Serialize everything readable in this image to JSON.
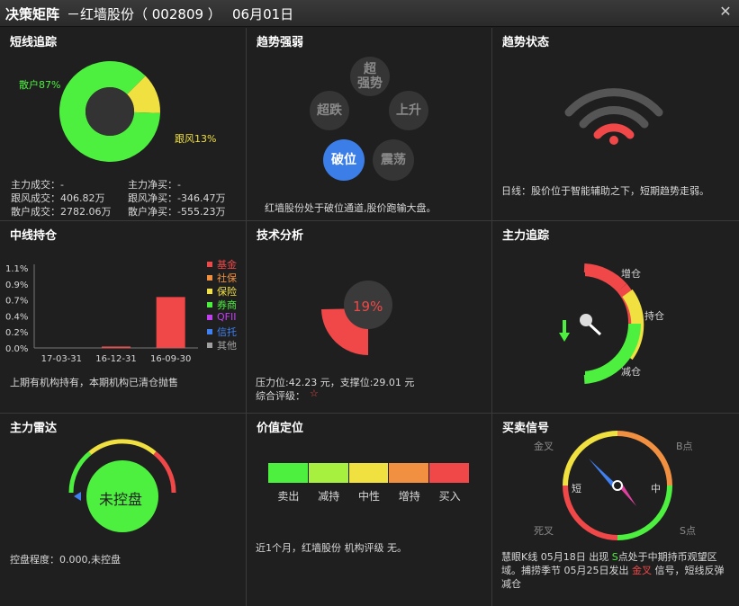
{
  "title_bar": {
    "title": "决策矩阵",
    "stock": "－红墙股份（ 002809 ）",
    "date": "06月01日",
    "close_icon": "close-icon"
  },
  "short_track": {
    "title": "短线追踪",
    "retail_pct_label": "散户87%",
    "follow_pct_label": "跟风13%",
    "retail_pct": 87,
    "follow_pct": 13,
    "rows": [
      [
        "主力成交：-",
        "主力净买：-"
      ],
      [
        "跟风成交：406.82万",
        "跟风净买：-346.47万"
      ],
      [
        "散户成交：2782.06万",
        "散户净买：-555.23万"
      ]
    ],
    "colors": {
      "retail": "#4ef040",
      "follow": "#f0e040"
    }
  },
  "trend_strength": {
    "title": "趋势强弱",
    "bubbles": {
      "super_strong": "超\n强势",
      "super_down": "超跌",
      "rise": "上升",
      "break": "破位",
      "shock": "震荡"
    },
    "active": "break",
    "desc": "红墙股份处于破位通道,股价跑输大盘。"
  },
  "trend_state": {
    "title": "趋势状态",
    "signal_level": 1,
    "signal_total": 4,
    "desc": "日线：股价位于智能辅助之下，短期趋势走弱。"
  },
  "mid_holding": {
    "title": "中线持仓",
    "chart_data": {
      "type": "bar",
      "categories": [
        "17-03-31",
        "16-12-31",
        "16-09-30"
      ],
      "values": [
        0,
        0.02,
        0.7
      ],
      "y_ticks": [
        "1.1%",
        "0.9%",
        "0.7%",
        "0.4%",
        "0.2%",
        "0.0%"
      ],
      "ylim": [
        0,
        1.1
      ],
      "bar_color": "#f04848"
    },
    "legend": [
      {
        "label": "基金",
        "color": "#f04848"
      },
      {
        "label": "社保",
        "color": "#f09040"
      },
      {
        "label": "保险",
        "color": "#f0e040"
      },
      {
        "label": "券商",
        "color": "#4ef040"
      },
      {
        "label": "QFII",
        "color": "#c040f0"
      },
      {
        "label": "信托",
        "color": "#4080f0"
      },
      {
        "label": "其他",
        "color": "#a0a0a0"
      }
    ],
    "desc": "上期有机构持有，本期机构已清仓抛售"
  },
  "tech_analysis": {
    "title": "技术分析",
    "pct_label": "19%",
    "pct": 19,
    "pressure": "压力位:42.23 元，支撑位:29.01 元",
    "rating_label": "综合评级：",
    "rating_star": "☆"
  },
  "main_track": {
    "title": "主力追踪",
    "labels": {
      "increase": "增仓",
      "hold": "持仓",
      "decrease": "减仓"
    },
    "arrow_icon": "arrow-down-icon"
  },
  "main_radar": {
    "title": "主力雷达",
    "center_label": "未控盘",
    "desc": "控盘程度：0.000,未控盘"
  },
  "value_position": {
    "title": "价值定位",
    "scale": [
      {
        "label": "卖出",
        "color": "#4ef040"
      },
      {
        "label": "减持",
        "color": "#a8f040"
      },
      {
        "label": "中性",
        "color": "#f0e040"
      },
      {
        "label": "增持",
        "color": "#f09040"
      },
      {
        "label": "买入",
        "color": "#f04848"
      }
    ],
    "desc": "近1个月，红墙股份 机构评级 无。"
  },
  "buy_sell": {
    "title": "买卖信号",
    "labels": {
      "gold_cross": "金叉",
      "b_point": "B点",
      "short": "短",
      "mid": "中",
      "dead_cross": "死叉",
      "s_point": "S点"
    },
    "desc_parts": {
      "p1": "慧眼K线 05月18日 出现 ",
      "s": "S",
      "p2": "点处于中期持币观望区域。捕捞季节 05月25日发出 ",
      "gc": "金叉",
      "p3": " 信号，短线反弹减仓"
    }
  }
}
